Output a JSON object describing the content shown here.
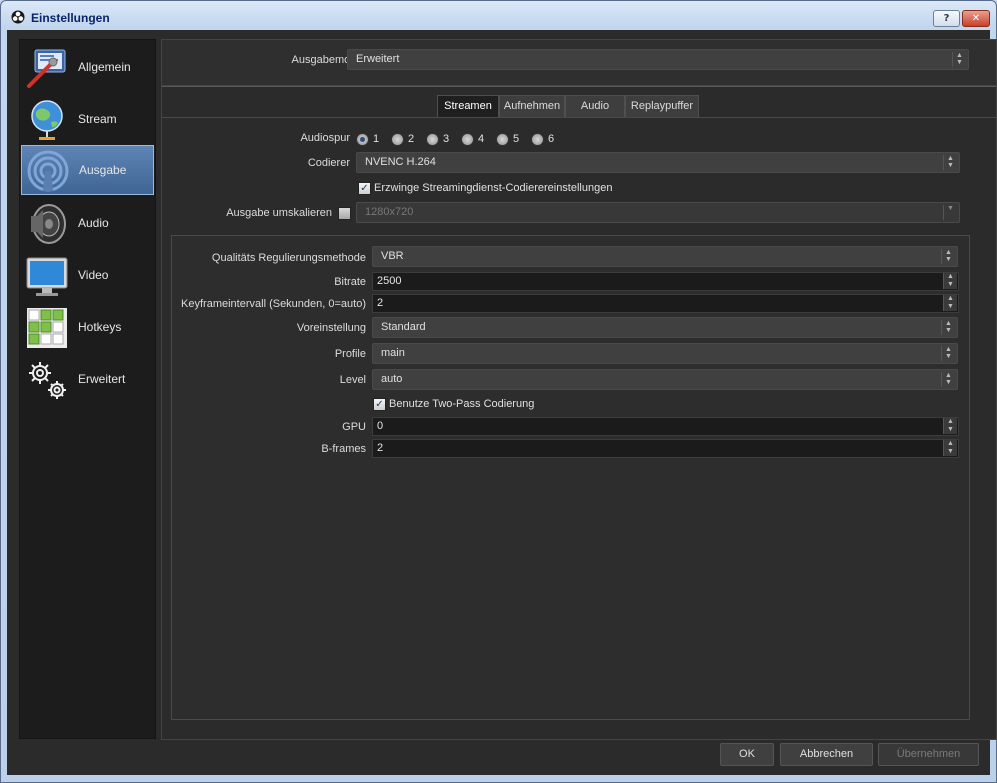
{
  "window": {
    "title": "Einstellungen",
    "help_label": "?",
    "close_label": "✕"
  },
  "sidebar": {
    "items": [
      {
        "label": "Allgemein",
        "icon": "general-icon"
      },
      {
        "label": "Stream",
        "icon": "globe-icon"
      },
      {
        "label": "Ausgabe",
        "icon": "broadcast-icon",
        "active": true
      },
      {
        "label": "Audio",
        "icon": "speaker-icon"
      },
      {
        "label": "Video",
        "icon": "monitor-icon"
      },
      {
        "label": "Hotkeys",
        "icon": "keyboard-icon"
      },
      {
        "label": "Erweitert",
        "icon": "gears-icon"
      }
    ]
  },
  "output_mode": {
    "label": "Ausgabemodus",
    "value": "Erweitert"
  },
  "tabs": [
    {
      "label": "Streamen",
      "active": true
    },
    {
      "label": "Aufnehmen"
    },
    {
      "label": "Audio"
    },
    {
      "label": "Replaypuffer"
    }
  ],
  "streaming": {
    "audiotrack": {
      "label": "Audiospur",
      "options": [
        "1",
        "2",
        "3",
        "4",
        "5",
        "6"
      ],
      "selected": "1"
    },
    "encoder": {
      "label": "Codierer",
      "value": "NVENC H.264"
    },
    "enforce": {
      "label": "Erzwinge Streamingdienst-Codierereinstellungen",
      "checked": true
    },
    "rescale": {
      "label": "Ausgabe umskalieren",
      "checked": false,
      "value": "1280x720"
    }
  },
  "encoder_settings": {
    "rate_control": {
      "label": "Qualitäts Regulierungsmethode",
      "value": "VBR"
    },
    "bitrate": {
      "label": "Bitrate",
      "value": "2500"
    },
    "keyframe": {
      "label": "Keyframeintervall (Sekunden, 0=auto)",
      "value": "2"
    },
    "preset": {
      "label": "Voreinstellung",
      "value": "Standard"
    },
    "profile": {
      "label": "Profile",
      "value": "main"
    },
    "level": {
      "label": "Level",
      "value": "auto"
    },
    "two_pass": {
      "label": "Benutze Two-Pass Codierung",
      "checked": true
    },
    "gpu": {
      "label": "GPU",
      "value": "0"
    },
    "bframes": {
      "label": "B-frames",
      "value": "2"
    }
  },
  "buttons": {
    "ok": "OK",
    "cancel": "Abbrechen",
    "apply": "Übernehmen"
  },
  "colors": {
    "accent": "#4f77a8",
    "background": "#2b2b2b",
    "sidebar": "#1c1c1c"
  }
}
